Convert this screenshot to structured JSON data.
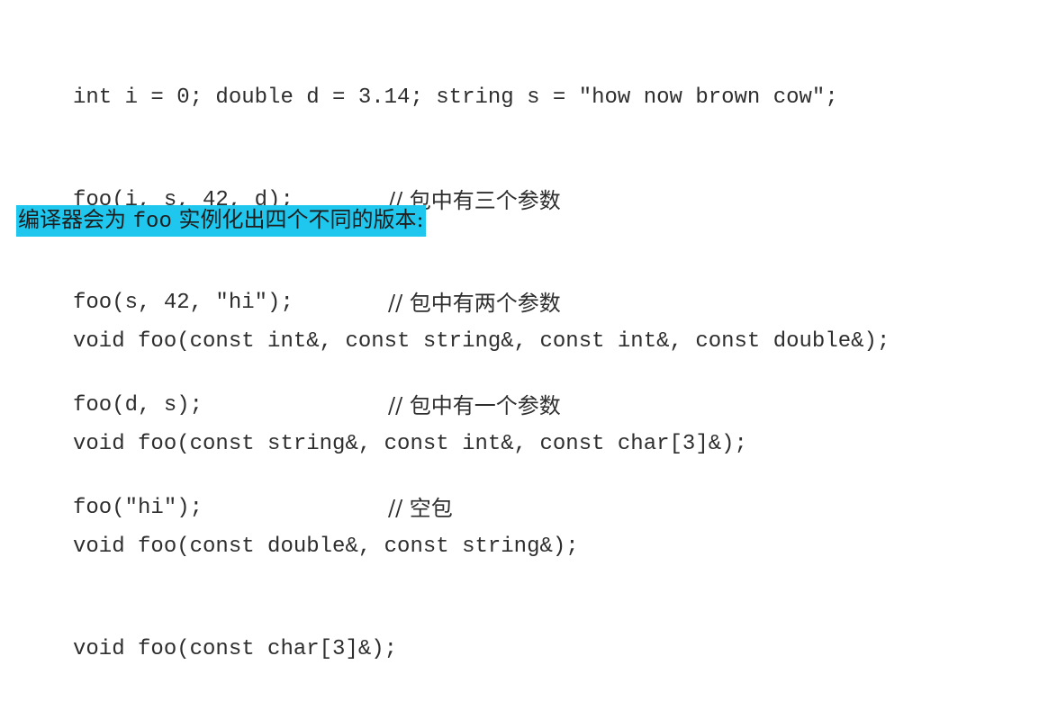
{
  "code_block_1": {
    "declaration": "int i = 0; double d = 3.14; string s = \"how now brown cow\";",
    "calls": [
      {
        "code": "foo(i, s, 42, d);",
        "comment": "// 包中有三个参数"
      },
      {
        "code": "foo(s, 42, \"hi\");",
        "comment": "// 包中有两个参数"
      },
      {
        "code": "foo(d, s);",
        "comment": "// 包中有一个参数"
      },
      {
        "code": "foo(\"hi\");",
        "comment": "// 空包"
      }
    ]
  },
  "prose": {
    "before": "编译器会为 ",
    "code_word": "foo",
    "after": " 实例化出四个不同的版本:"
  },
  "code_block_2": {
    "lines": [
      "void foo(const int&, const string&, const int&, const double&);",
      "void foo(const string&, const int&, const char[3]&);",
      "void foo(const double&, const string&);",
      "void foo(const char[3]&);"
    ]
  },
  "colors": {
    "highlight": "#1fc6ee",
    "text": "#2e2e2e"
  }
}
